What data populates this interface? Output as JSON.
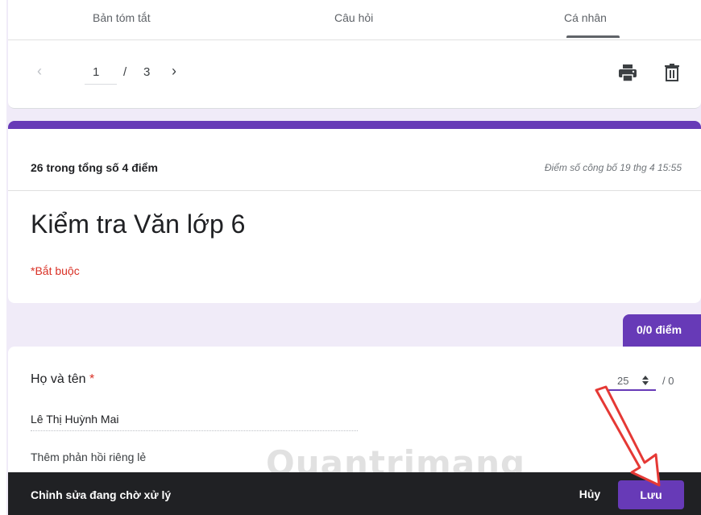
{
  "tabs": [
    {
      "label": "Bản tóm tắt"
    },
    {
      "label": "Câu hỏi"
    },
    {
      "label": "Cá nhân"
    }
  ],
  "pager": {
    "current": "1",
    "separator": "/",
    "total": "3"
  },
  "score": {
    "text": "26 trong tổng số 4 điểm",
    "published": "Điểm số công bố 19 thg 4 15:55"
  },
  "form": {
    "title": "Kiểm tra Văn lớp 6",
    "required_note": "*Bắt buộc"
  },
  "points_badge": "0/0 điểm",
  "question": {
    "label": "Họ và tên",
    "required_star": "*",
    "score_value": "25",
    "score_max": "/ 0",
    "answer": "Lê Thị Huỳnh Mai",
    "feedback_link": "Thêm phản hồi riêng lẻ"
  },
  "watermark": "Quantrimang",
  "bottom_bar": {
    "pending": "Chỉnh sửa đang chờ xử lý",
    "cancel_label": "Hủy",
    "save_label": "Lưu"
  },
  "colors": {
    "accent": "#673ab7",
    "background": "#f0ebf8",
    "annotation_arrow": "#e53935"
  },
  "icons": {
    "print": "print-icon",
    "delete": "trash-icon",
    "prev": "chevron-left-icon",
    "next": "chevron-right-icon",
    "spinner": "spinner-icon"
  }
}
